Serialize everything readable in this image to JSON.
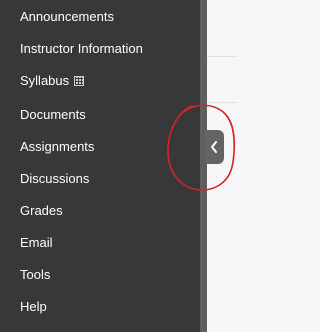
{
  "sidebar": {
    "items": [
      {
        "label": "Announcements"
      },
      {
        "label": "Instructor Information"
      },
      {
        "label": "Syllabus",
        "icon": "grid-icon"
      },
      {
        "label": "Documents"
      },
      {
        "label": "Assignments"
      },
      {
        "label": "Discussions"
      },
      {
        "label": "Grades"
      },
      {
        "label": "Email"
      },
      {
        "label": "Tools"
      },
      {
        "label": "Help"
      }
    ]
  },
  "collapse_toggle": {
    "icon": "chevron-left-icon"
  },
  "annotation": {
    "shape": "circle",
    "color": "#d4232a"
  },
  "colors": {
    "sidebar_background": "#383838",
    "sidebar_text": "#ffffff",
    "content_background": "#f7f7f7",
    "toggle_background": "#646464"
  }
}
